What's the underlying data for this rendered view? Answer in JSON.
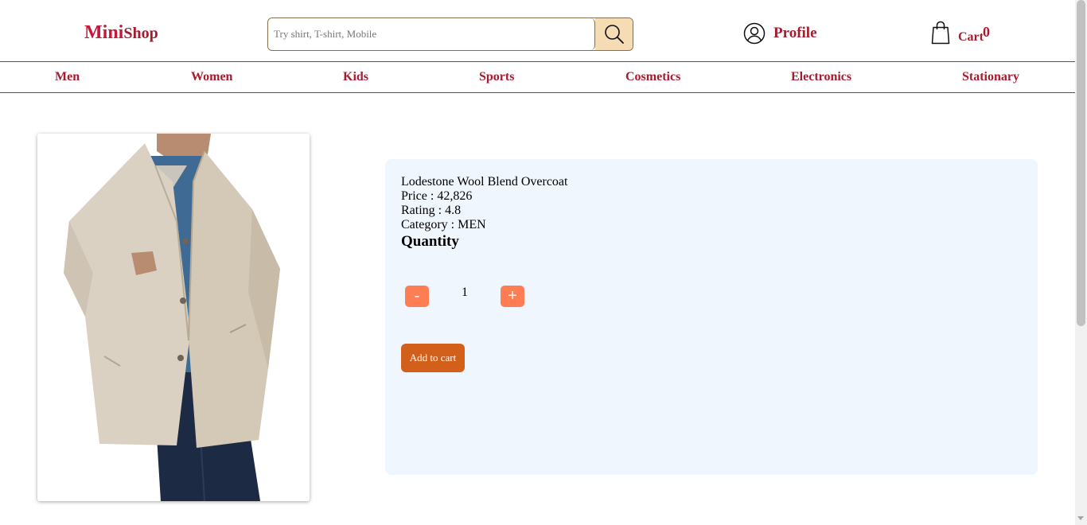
{
  "header": {
    "logo_part1": "Mini",
    "logo_part2": "Shop",
    "search_placeholder": "Try shirt, T-shirt, Mobile",
    "search_icon": "search-icon",
    "profile_label": "Profile",
    "profile_icon": "user-circle-icon",
    "cart_label": "Cart",
    "cart_count": "0",
    "cart_icon": "shopping-bag-icon"
  },
  "nav": {
    "items": [
      "Men",
      "Women",
      "Kids",
      "Sports",
      "Cosmetics",
      "Electronics",
      "Stationary"
    ]
  },
  "product": {
    "name": "Lodestone Wool Blend Overcoat",
    "price_label": "Price : 42,826",
    "rating_label": "Rating : 4.8",
    "category_label": "Category : MEN",
    "quantity_title": "Quantity",
    "quantity_value": "1",
    "minus_label": "-",
    "plus_label": "+",
    "add_to_cart_label": "Add to cart"
  },
  "colors": {
    "brand_red": "#a51c30",
    "logo_red": "#c8173a",
    "qty_button": "#ff7d52",
    "add_button": "#d2601a",
    "details_bg": "#eff6fd",
    "search_button_bg": "#f5dcb4"
  }
}
